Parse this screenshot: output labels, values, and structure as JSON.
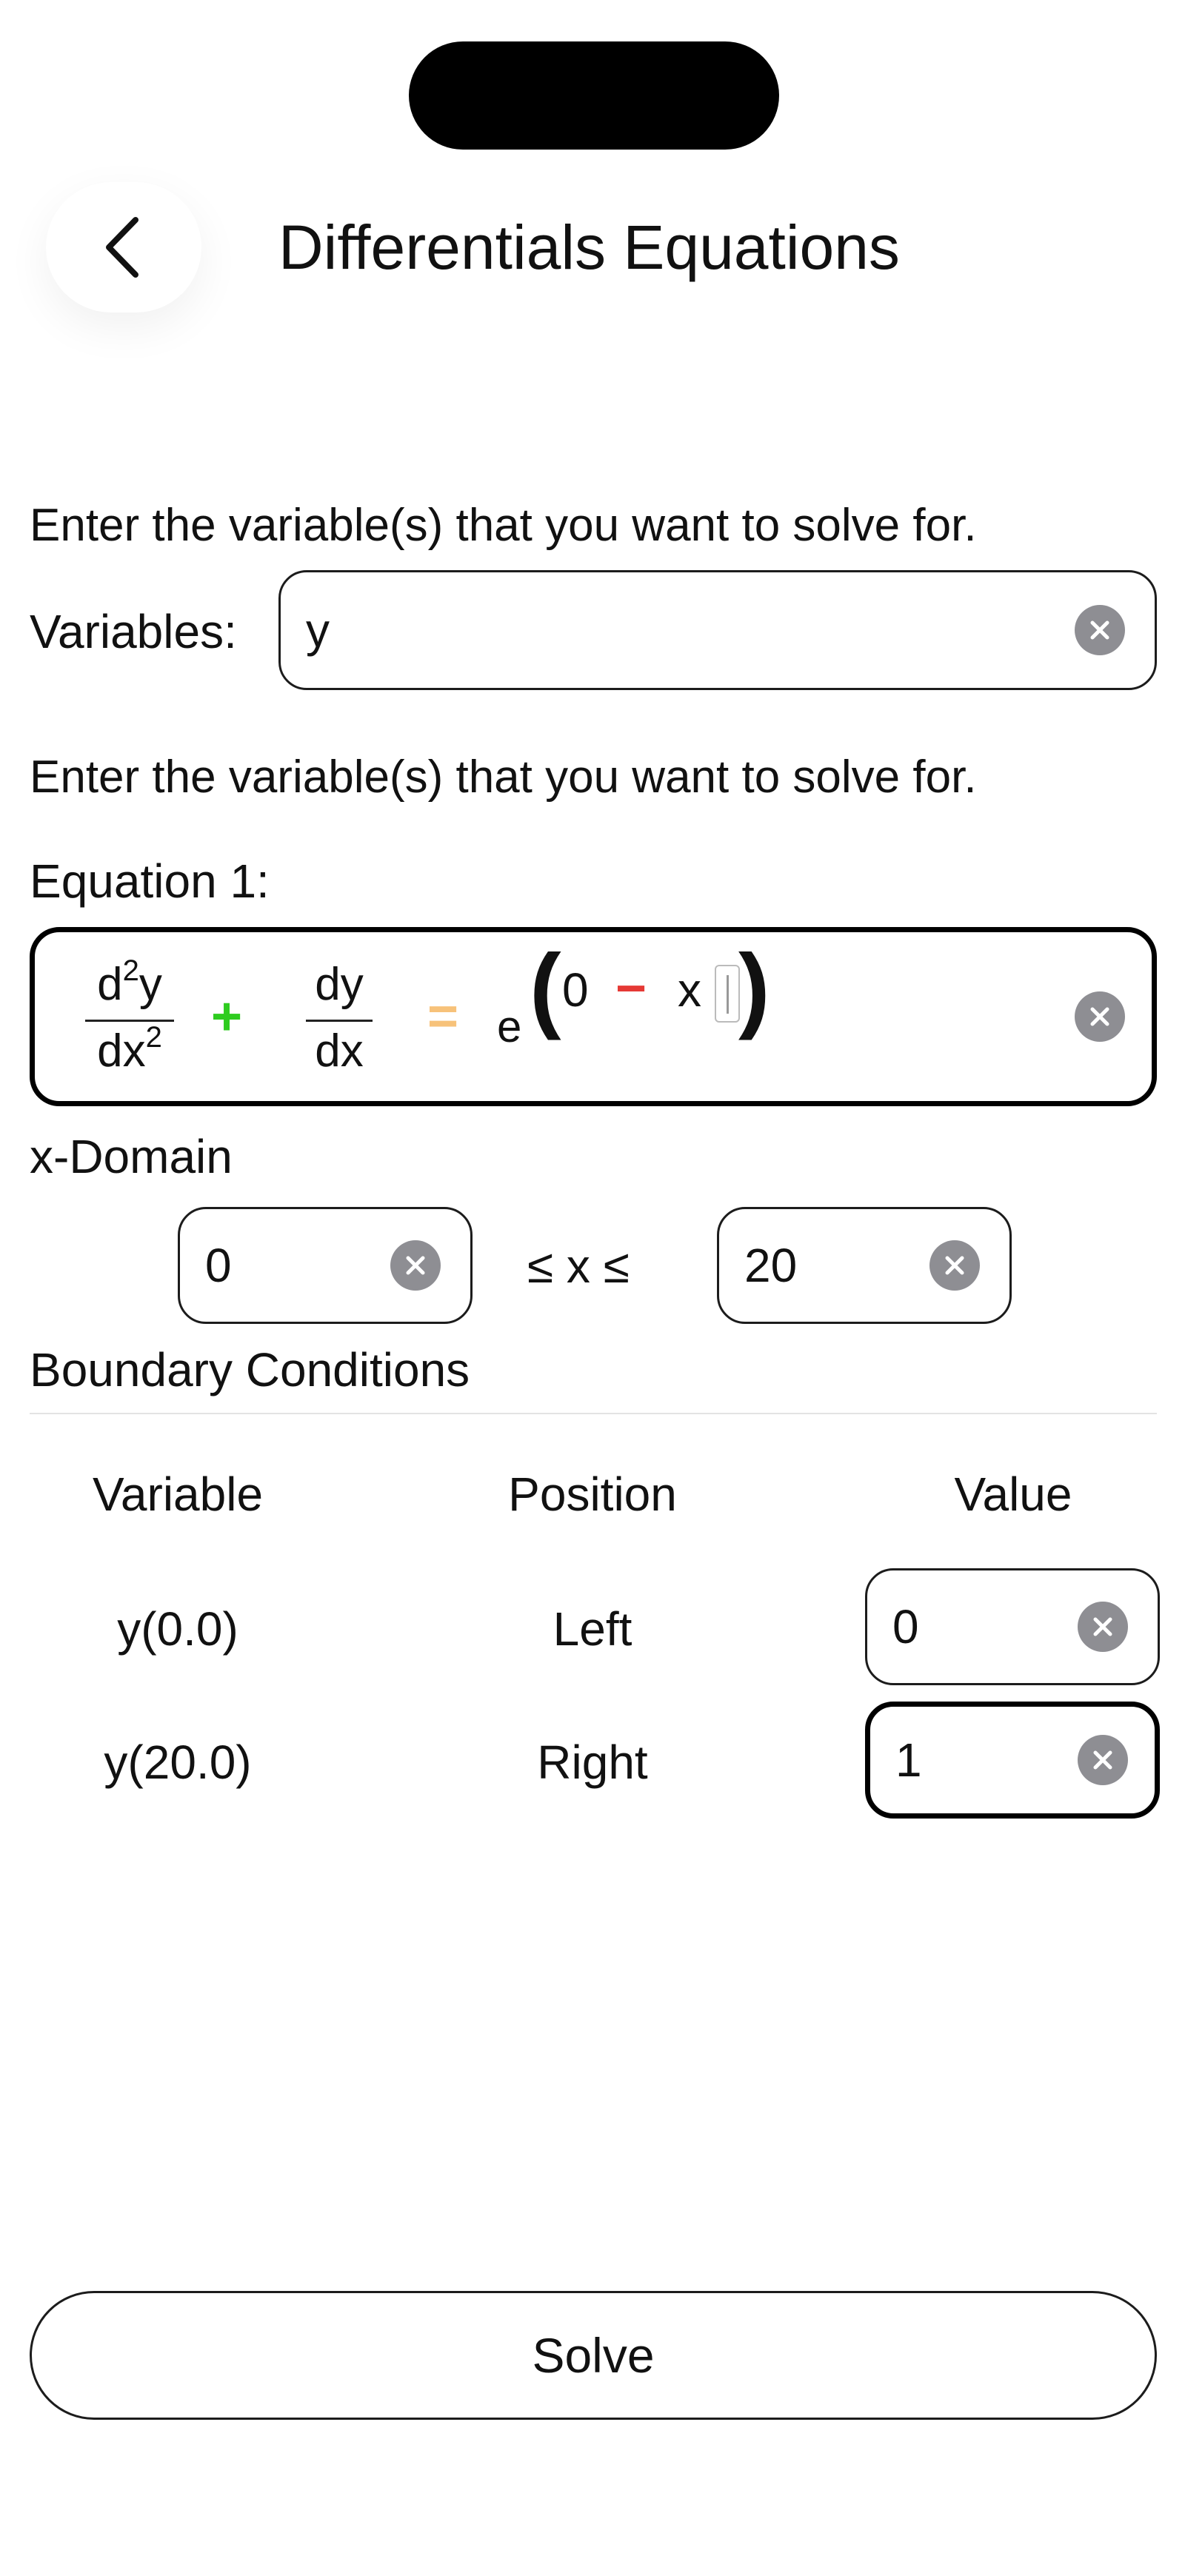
{
  "header": {
    "title": "Differentials Equations"
  },
  "variables_section": {
    "instruction": "Enter the variable(s) that you want to solve for.",
    "label": "Variables:",
    "value": "y"
  },
  "equation_section": {
    "instruction": "Enter the variable(s) that you want to solve for.",
    "label": "Equation 1:",
    "term1": {
      "num_d": "d",
      "num_exp": "2",
      "num_var": "y",
      "den_d": "d",
      "den_var": "x",
      "den_exp": "2"
    },
    "plus": "+",
    "term2": {
      "num": "dy",
      "den": "dx"
    },
    "equals": "=",
    "rhs": {
      "base": "e",
      "open_paren": "(",
      "zero": "0",
      "minus": "−",
      "x": "x",
      "close_paren": ")"
    },
    "colors": {
      "plus": "#2ecc1f",
      "equals": "#f7c27a",
      "minus": "#e53935"
    }
  },
  "x_domain": {
    "label": "x-Domain",
    "lower": "0",
    "relation": "≤ x ≤",
    "upper": "20"
  },
  "boundary_conditions": {
    "title": "Boundary Conditions",
    "headers": {
      "variable": "Variable",
      "position": "Position",
      "value": "Value"
    },
    "rows": [
      {
        "variable": "y(0.0)",
        "position": "Left",
        "value": "0"
      },
      {
        "variable": "y(20.0)",
        "position": "Right",
        "value": "1"
      }
    ]
  },
  "solve_button": {
    "label": "Solve"
  }
}
